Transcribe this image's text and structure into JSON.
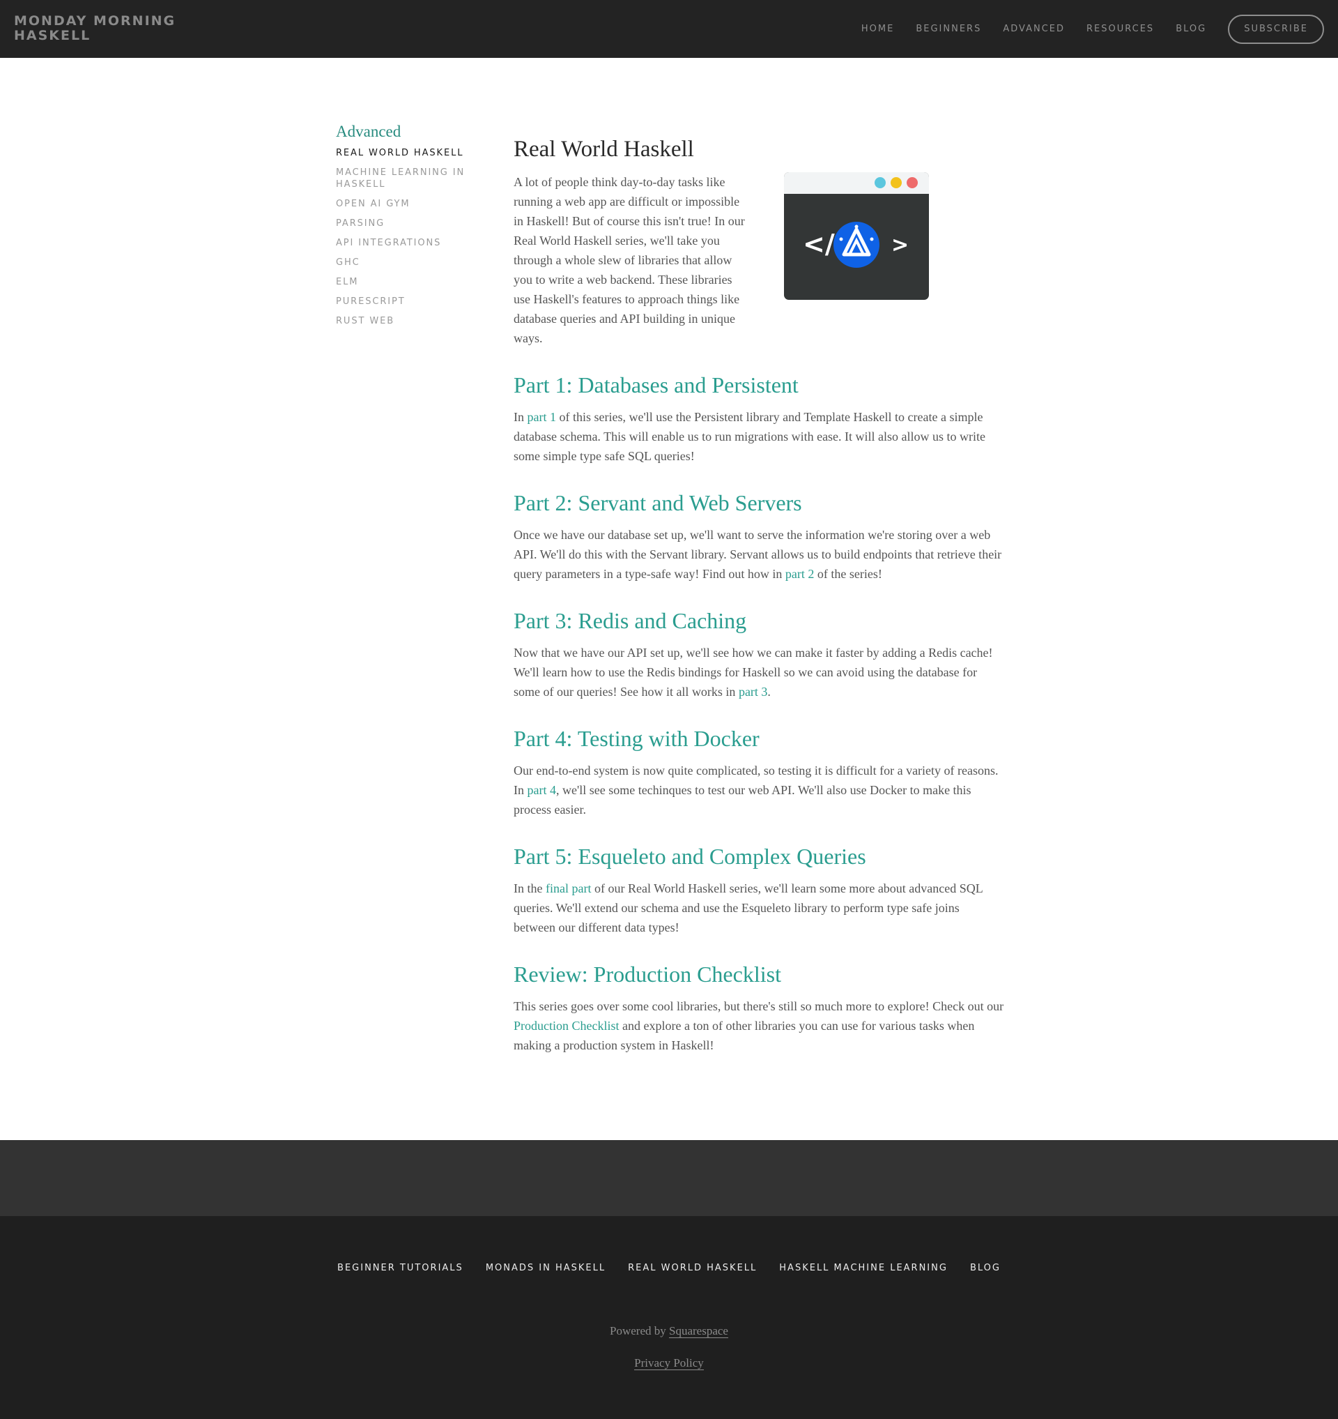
{
  "header": {
    "logo": "MONDAY MORNING HASKELL",
    "nav": [
      "HOME",
      "BEGINNERS",
      "ADVANCED",
      "RESOURCES",
      "BLOG"
    ],
    "subscribe": "SUBSCRIBE"
  },
  "sidebar": {
    "title": "Advanced",
    "items": [
      {
        "label": "REAL WORLD HASKELL",
        "active": true
      },
      {
        "label": "MACHINE LEARNING IN HASKELL"
      },
      {
        "label": "OPEN AI GYM"
      },
      {
        "label": "PARSING"
      },
      {
        "label": "API INTEGRATIONS"
      },
      {
        "label": "GHC"
      },
      {
        "label": "ELM"
      },
      {
        "label": "PURESCRIPT"
      },
      {
        "label": "RUST WEB"
      }
    ]
  },
  "article": {
    "title": "Real World Haskell",
    "intro": "A lot of people think day-to-day tasks like running a web app are difficult or impossible in Haskell! But of course this isn't true! In our Real World Haskell series, we'll take you through a whole slew of libraries that allow you to write a web backend. These libraries use Haskell's features to approach things like database queries and API building in unique ways.",
    "hero_image": {
      "left_glyph": "</",
      "right_glyph": ">",
      "dot_colors": [
        "#5bc6de",
        "#f3c21b",
        "#ee6b6b"
      ],
      "circle_color": "#0f62e6",
      "window_color": "#333636"
    },
    "sections": [
      {
        "heading": "Part 1: Databases and Persistent",
        "before": "In ",
        "link": "part 1",
        "after": " of this series, we'll use the Persistent library and Template Haskell to create a simple database schema. This will enable us to run migrations with ease. It will also allow us to write some simple type safe SQL queries!"
      },
      {
        "heading": "Part 2: Servant and Web Servers",
        "before": "Once we have our database set up, we'll want to serve the information we're storing over a web API. We'll do this with the Servant library. Servant allows us to build endpoints that retrieve their query parameters in a type-safe way! Find out how in ",
        "link": "part 2",
        "after": " of the series!"
      },
      {
        "heading": "Part 3: Redis and Caching",
        "before": "Now that we have our API set up, we'll see how we can make it faster by adding a Redis cache! We'll learn how to use the Redis bindings for Haskell so we can avoid using the database for some of our queries! See how it all works in ",
        "link": "part 3",
        "after": "."
      },
      {
        "heading": "Part 4: Testing with Docker",
        "before": "Our end-to-end system is now quite complicated, so testing it is difficult for a variety of reasons. In ",
        "link": "part 4",
        "after": ", we'll see some techinques to test our web API. We'll also use Docker to make this process easier."
      },
      {
        "heading": "Part 5: Esqueleto and Complex Queries",
        "before": "In the ",
        "link": "final part",
        "after": " of our Real World Haskell series, we'll learn some more about advanced SQL queries. We'll extend our schema and use the Esqueleto library to perform type safe joins between our different data types!"
      },
      {
        "heading": "Review: Production Checklist",
        "before": "This series goes over some cool libraries, but there's still so much more to explore! Check out our ",
        "link": "Production Checklist",
        "after": " and explore a ton of other libraries you can use for various tasks when making a production system in Haskell!"
      }
    ]
  },
  "footer": {
    "links": [
      "BEGINNER TUTORIALS",
      "MONADS IN HASKELL",
      "REAL WORLD HASKELL",
      "HASKELL MACHINE LEARNING",
      "BLOG"
    ],
    "powered_prefix": "Powered by ",
    "powered_link": "Squarespace",
    "privacy": "Privacy Policy"
  }
}
